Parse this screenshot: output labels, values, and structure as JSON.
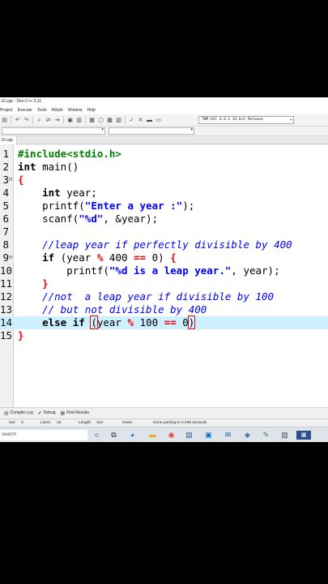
{
  "window": {
    "title": "10.cpp - Dev-C++ 5.11"
  },
  "menu": [
    "Project",
    "Execute",
    "Tools",
    "AStyle",
    "Window",
    "Help"
  ],
  "toolbar": {
    "compiler": "TDM-GCC 4.9.2 32-bit Release"
  },
  "tabs": [
    {
      "label": "10.cpp"
    }
  ],
  "editor": {
    "lines": [
      {
        "num": "1",
        "html": "<span class=\"pp\">#include&lt;stdio.h&gt;</span>"
      },
      {
        "num": "2",
        "html": "<span class=\"kw\">int</span> main()"
      },
      {
        "num": "3",
        "html": "<span class=\"brace\">{</span>",
        "fold": "⊟"
      },
      {
        "num": "4",
        "html": "    <span class=\"kw\">int</span> year;"
      },
      {
        "num": "5",
        "html": "    printf(<span class=\"str\">\"Enter a year :\"</span>);"
      },
      {
        "num": "6",
        "html": "    scanf(<span class=\"str\">\"%d\"</span>, &amp;year);"
      },
      {
        "num": "7",
        "html": ""
      },
      {
        "num": "8",
        "html": "    <span class=\"cmt\">//leap year if perfectly divisible by 400</span>"
      },
      {
        "num": "9",
        "html": "    <span class=\"kw\">if</span> (year <span class=\"op\">%</span> 400 <span class=\"op\">==</span> 0) <span class=\"brace\">{</span>",
        "fold": "⊟"
      },
      {
        "num": "10",
        "html": "        printf(<span class=\"str\">\"%d is a leap year.\"</span>, year);"
      },
      {
        "num": "11",
        "html": "    <span class=\"brace\">}</span>"
      },
      {
        "num": "12",
        "html": "    <span class=\"cmt\">//not  a leap year if divisible by 100</span>"
      },
      {
        "num": "13",
        "html": "    <span class=\"cmt\">// but not divisible by 400</span>"
      },
      {
        "num": "14",
        "html": "    <span class=\"kw\">else if</span> <span class=\"caret-box\">(</span>year <span class=\"op\">%</span> 100 <span class=\"op\">==</span> 0<span class=\"caret-box\">)</span>",
        "current": true
      },
      {
        "num": "15",
        "html": "<span class=\"brace\">}</span>"
      }
    ]
  },
  "bottom_tabs": [
    {
      "label": "Compile Log",
      "icon": "▤"
    },
    {
      "label": "Debug",
      "icon": "✔"
    },
    {
      "label": "Find Results",
      "icon": "▦"
    }
  ],
  "status": {
    "sel": "Sel:",
    "sel_val": "0",
    "lines": "Lines:",
    "lines_val": "15",
    "length": "Length:",
    "length_val": "313",
    "mode": "Insert",
    "msg": "Done parsing in 0.235 seconds"
  },
  "taskbar": {
    "search_placeholder": "search"
  }
}
